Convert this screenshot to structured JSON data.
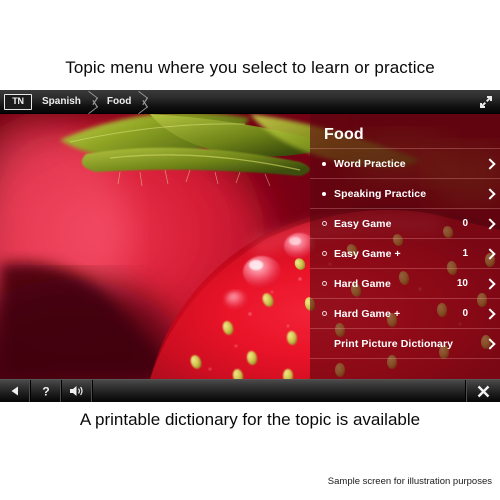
{
  "captions": {
    "top": "Topic menu where you select to learn or practice",
    "bottom": "A printable dictionary for the topic is available",
    "disclaimer": "Sample screen for illustration purposes"
  },
  "breadcrumb": {
    "logo": "TN",
    "items": [
      {
        "label": "Spanish"
      },
      {
        "label": "Food"
      }
    ],
    "expand_icon": "expand-fullscreen-icon"
  },
  "panel": {
    "title": "Food",
    "items": [
      {
        "label": "Word Practice",
        "value": "",
        "bullet": "filled",
        "chevron": "chevron-right-icon"
      },
      {
        "label": "Speaking Practice",
        "value": "",
        "bullet": "filled",
        "chevron": "chevron-right-icon"
      },
      {
        "label": "Easy Game",
        "value": "0",
        "bullet": "hollow",
        "chevron": "chevron-right-icon"
      },
      {
        "label": "Easy Game +",
        "value": "1",
        "bullet": "hollow",
        "chevron": "chevron-right-icon"
      },
      {
        "label": "Hard Game",
        "value": "10",
        "bullet": "hollow",
        "chevron": "chevron-right-icon"
      },
      {
        "label": "Hard Game +",
        "value": "0",
        "bullet": "hollow",
        "chevron": "chevron-right-icon"
      },
      {
        "label": "Print Picture Dictionary",
        "value": "",
        "bullet": "none",
        "chevron": "chevron-right-icon"
      }
    ]
  },
  "toolbar": {
    "back_icon": "back-triangle-icon",
    "help_icon": "question-mark-icon",
    "sound_icon": "speaker-volume-icon",
    "close_icon": "close-x-icon"
  },
  "photo": {
    "description": "macro photo of a red strawberry with green leaves and yellow seeds",
    "colors": {
      "deep_red": "#6d0210",
      "bright_red": "#e8162a",
      "pink_red": "#f0315a",
      "leaf_green": "#93a828",
      "seed_yellow": "#d8d24e"
    }
  },
  "theme": {
    "panel_overlay": "#5c060e",
    "bar_dark": "#1b1b1b",
    "text_white": "#ffffff",
    "caption_black": "#0a0a0a"
  }
}
